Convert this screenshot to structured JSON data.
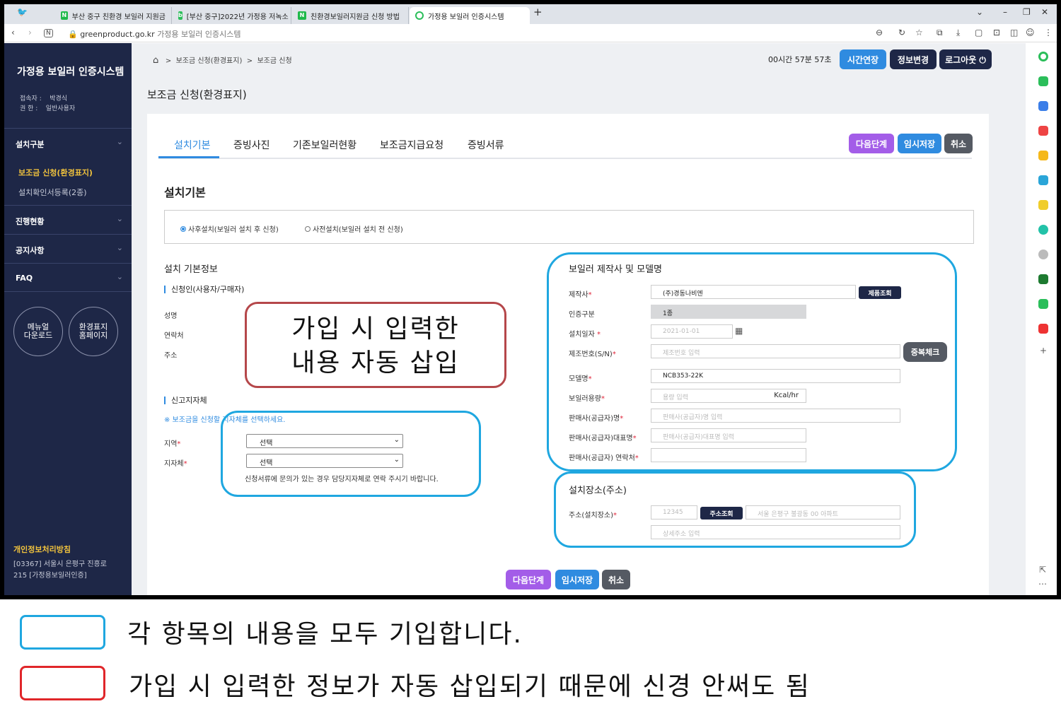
{
  "browser": {
    "tabs": [
      {
        "label": "부산 중구 친환경 보일러 지원금",
        "fav": "N",
        "favcolor": "#1fb94a"
      },
      {
        "label": "[부산 중구]2022년 가정용 저녹소",
        "fav": "B",
        "favcolor": "#2bbe5a"
      },
      {
        "label": "친환경보일러지원금 신청 방법",
        "fav": "N",
        "favcolor": "#1fb94a"
      },
      {
        "label": "가정용 보일러 인증시스템",
        "fav": "○",
        "favcolor": "#2bbe5a"
      }
    ],
    "new_tab": "+",
    "url_domain": "greenproduct.go.kr",
    "url_title": "가정용 보일러 인증시스템"
  },
  "sidebar": {
    "title": "가정용 보일러 인증시스템",
    "user_label": "접속자 :",
    "user_name": "박경식",
    "role_label": "권 한 :",
    "role_name": "일반사용자",
    "sections": [
      "설치구분",
      "진행현황",
      "공지사항",
      "FAQ"
    ],
    "sub_items": [
      "보조금 신청(환경표지)",
      "설치확인서등록(2종)"
    ],
    "circle_manual": "메뉴얼\n다운로드",
    "circle_homepage": "환경표지\n홈페이지",
    "policy": "개인정보처리방침",
    "address_line1": "[03367] 서울시 은평구 진흥로",
    "address_line2": "215 [가정용보일러인증]"
  },
  "topbar": {
    "breadcrumb_1": "보조금 신청(환경표지)",
    "breadcrumb_2": "보조금 신청",
    "sep": ">",
    "timer": "00시간 57분 57초",
    "btn_extend": "시간연장",
    "btn_info": "정보변경",
    "btn_logout": "로그아웃 ⏻"
  },
  "page": {
    "title": "보조금 신청(환경표지)",
    "tabs": [
      "설치기본",
      "증빙사진",
      "기존보일러현황",
      "보조금지급요청",
      "증빙서류"
    ],
    "btn_next": "다음단계",
    "btn_save": "임시저장",
    "btn_cancel": "취소",
    "section_title": "설치기본",
    "radio_after": "사후설치(보일러 설치 후 신청)",
    "radio_before": "사전설치(보일러 설치 전 신청)",
    "basic_info_title": "설치 기본정보",
    "applicant_label": "신청인(사용자/구매자)",
    "name_label": "성명",
    "contact_label": "연락처",
    "address_label": "주소",
    "local_gov_label": "신고지자체",
    "local_gov_notice": "※ 보조금을 신청할 지자체를 선택하세요.",
    "region_label": "지역",
    "gov_label": "지자체",
    "select_placeholder": "선택",
    "gov_note": "신청서류에 문의가 있는 경우 담당지자체로 연락 주시기 바랍니다.",
    "maker_title": "보일러 제작사 및 모델명",
    "maker_label": "제작사",
    "maker_value": "(주)경동나비엔",
    "product_search": "제품조회",
    "cert_label": "인증구분",
    "cert_value": "1종",
    "install_date_label": "설치일자",
    "install_date_placeholder": "2021-01-01",
    "serial_label": "제조번호(S/N)",
    "serial_placeholder": "제조번호 입력",
    "dup_check": "중복체크",
    "model_label": "모델명",
    "model_value": "NCB353-22K",
    "capacity_label": "보일러용량",
    "capacity_placeholder": "용량 입력",
    "capacity_unit": "Kcal/hr",
    "seller_label": "판매사(공급자)명",
    "seller_placeholder": "판매사(공급자)명 입력",
    "seller_rep_label": "판매사(공급자)대표명",
    "seller_rep_placeholder": "판매사(공급자)대표명 입력",
    "seller_contact_label": "판매사(공급자) 연락처",
    "place_title": "설치장소(주소)",
    "place_addr_label": "주소(설치장소)",
    "zip_placeholder": "12345",
    "addr_search": "주소조회",
    "addr_placeholder": "서울 은평구 불광동 00 아파트",
    "detail_placeholder": "상세주소 입력",
    "required_mark": "*"
  },
  "annotations": {
    "red_box_line1": "가입 시 입력한",
    "red_box_line2": "내용 자동 삽입",
    "legend_blue": "각 항목의 내용을 모두 기입합니다.",
    "legend_red": "가입 시 입력한 정보가 자동 삽입되기 때문에 신경 안써도 됨"
  },
  "colors": {
    "sidebar": "#1e2747",
    "accent_blue": "#2f8be0",
    "btn_purple": "#a35de8",
    "btn_blue": "#2f8be0",
    "btn_gray": "#555a63",
    "annotation_blue": "#1fa7e0",
    "annotation_red": "#e0262a"
  }
}
